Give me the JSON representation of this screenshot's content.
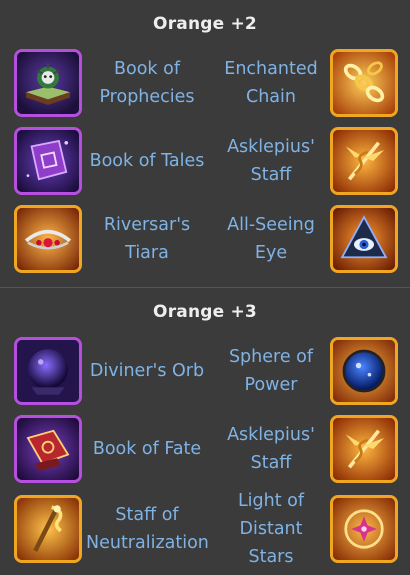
{
  "sections": [
    {
      "title": "Orange +2",
      "rows": [
        {
          "left": {
            "name": "Book of Prophecies",
            "icon": "book-of-prophecies-icon",
            "frame": "purple"
          },
          "right": {
            "name": "Enchanted Chain",
            "icon": "enchanted-chain-icon",
            "frame": "orange"
          }
        },
        {
          "left": {
            "name": "Book of Tales",
            "icon": "book-of-tales-icon",
            "frame": "purple"
          },
          "right": {
            "name": "Asklepius' Staff",
            "icon": "asklepius-staff-icon",
            "frame": "orange"
          }
        },
        {
          "left": {
            "name": "Riversar's Tiara",
            "icon": "riversars-tiara-icon",
            "frame": "orange"
          },
          "right": {
            "name": "All-Seeing Eye",
            "icon": "all-seeing-eye-icon",
            "frame": "orange"
          }
        }
      ]
    },
    {
      "title": "Orange +3",
      "rows": [
        {
          "left": {
            "name": "Diviner's Orb",
            "icon": "diviners-orb-icon",
            "frame": "purple"
          },
          "right": {
            "name": "Sphere of Power",
            "icon": "sphere-of-power-icon",
            "frame": "orange"
          }
        },
        {
          "left": {
            "name": "Book of Fate",
            "icon": "book-of-fate-icon",
            "frame": "purple"
          },
          "right": {
            "name": "Asklepius' Staff",
            "icon": "asklepius-staff-icon",
            "frame": "orange"
          }
        },
        {
          "left": {
            "name": "Staff of Neutralization",
            "icon": "staff-of-neutralization-icon",
            "frame": "orange"
          },
          "right": {
            "name": "Light of Distant Stars",
            "icon": "light-of-distant-stars-icon",
            "frame": "orange"
          }
        }
      ]
    }
  ],
  "colors": {
    "background": "#3b3b3b",
    "item_text": "#7fb3e6",
    "purple_frame": "#b64fe0",
    "orange_frame": "#f0a620"
  }
}
